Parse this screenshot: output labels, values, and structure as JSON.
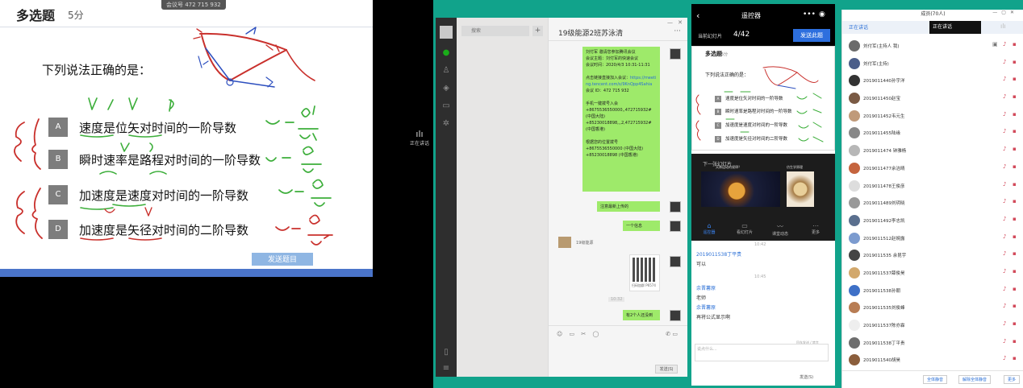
{
  "slide": {
    "title": "多选题",
    "score": "5分",
    "meeting_tag": "会议号 472 715 932",
    "question": "下列说法正确的是：",
    "options": [
      {
        "letter": "A",
        "text": "速度是位矢对时间的一阶导数"
      },
      {
        "letter": "B",
        "text": "瞬时速率是路程对时间的一阶导数"
      },
      {
        "letter": "C",
        "text": "加速度是速度对时间的一阶导数"
      },
      {
        "letter": "D",
        "text": "加速度是矢径对时间的二阶导数"
      }
    ],
    "send_button": "发送题目"
  },
  "speaker_indicator": "正在讲话",
  "wechat": {
    "search_placeholder": "搜索",
    "chat_title": "19级能源2班苏泳清",
    "chat_more": "···",
    "invite_text": "刘付军 邀请您参加腾讯会议\n会议主题：刘付军的快速会议\n会议时间：2020/4/3 10:31-11:31\n\n点击链接直接加入会议：",
    "invite_link": "https://meeting.tencent.com/s/9KnQpp4Sahia",
    "invite_text2": "\n会议 ID：472 715 932\n\n手机一键拨号入会\n+8675536550000,,472715932# (中国大陆)\n+85230018898,,,2,472715932# (中国香港)\n\n根据您的位置拨号\n+8675536550000 (中国大陆)\n+85230018898 (中国香港)",
    "msg2": "注意最新上传的",
    "msg3": "一个信息",
    "recv_name": "19级能源",
    "qr_caption": "扫码加群 P6574",
    "timestamp": "10:32",
    "msg4": "有2个人还没到",
    "tools": "☺ ▭ ✂ ◯",
    "tools_r": "✆ ▭",
    "send": "发送(S)"
  },
  "remote": {
    "title": "遥控器",
    "current_label": "当前幻灯片",
    "page": "4/42",
    "send_btn": "发送此题",
    "thumb_title": "多选题",
    "thumb_score": "5分",
    "thumb_q": "下列说法正确的是：",
    "thumb_opts": [
      "速度是位矢对时间的一阶导数",
      "瞬时速率是路程对时间的一阶导数",
      "加速度是速度对时间的一阶导数",
      "加速度是矢径对时间的二阶导数"
    ],
    "next_label": "下一张幻灯片",
    "next_cap1": "天体运动的规律？",
    "next_cap2": "仿生学原理",
    "tabs": [
      {
        "icon": "⌂",
        "label": "遥控器"
      },
      {
        "icon": "▭",
        "label": "看幻灯片"
      },
      {
        "icon": "〰",
        "label": "课堂动态"
      },
      {
        "icon": "⋯",
        "label": "更多"
      }
    ],
    "chat": [
      {
        "type": "time",
        "text": "10:42"
      },
      {
        "type": "name",
        "text": "2019011538丁平贵"
      },
      {
        "type": "msg",
        "text": "可以"
      },
      {
        "type": "time",
        "text": "10:45"
      },
      {
        "type": "name",
        "text": "余晋薯原"
      },
      {
        "type": "msg",
        "text": "老师"
      },
      {
        "type": "name",
        "text": "余晋薯原"
      },
      {
        "type": "msg",
        "text": "再将公式显示啊"
      }
    ],
    "input_placeholder": "说点什么...",
    "input_hint": "回车发送 / 禁言",
    "send": "发送(S)"
  },
  "members": {
    "title": "成员(70人)",
    "tab1": "正在讲话",
    "tab2": "正在讲话",
    "rows": [
      "刘付军(主持人 我)",
      "刘付军(主持)",
      "2019011440孙宇洋",
      "2019011450赵宝",
      "2019011452韦元生",
      "2019011455陆缘",
      "2019011474 钟雅杨",
      "2019011477余洁晴",
      "2019011478王俊彦",
      "2019011489刘玥晓",
      "2019011492李志凯",
      "2019011512赵婉露",
      "2019011535 余昆宇",
      "2019011537薛俊昊",
      "2019011538孙朝",
      "2019011535刘俊峰",
      "2019011537陈亦霖",
      "2019011538丁平贵",
      "2019011540胡昊"
    ],
    "btn1": "全体静音",
    "btn2": "解除全体静音",
    "btn3": "更多"
  }
}
